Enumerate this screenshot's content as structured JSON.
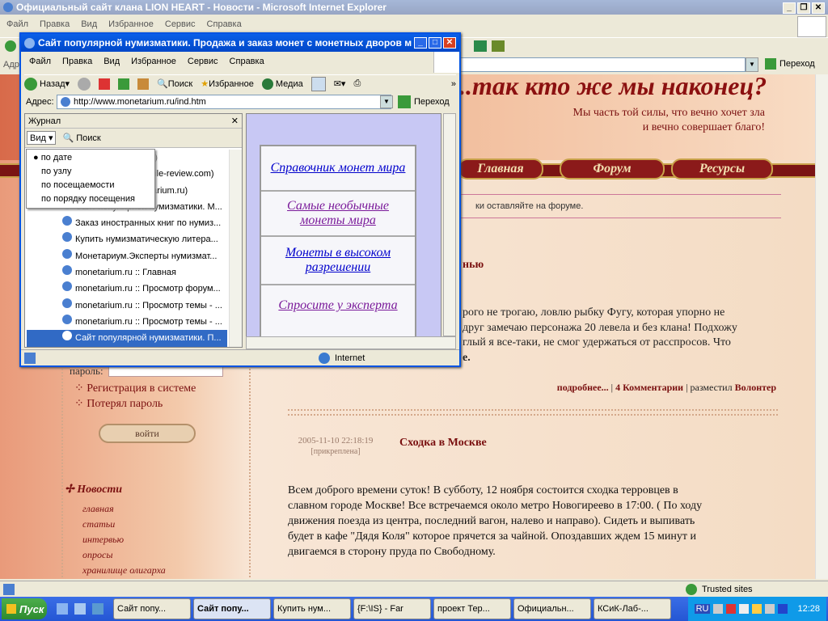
{
  "main_window": {
    "title": "Официальный сайт клана LION HEART - Новости - Microsoft Internet Explorer",
    "menu": [
      "Файл",
      "Правка",
      "Вид",
      "Избранное",
      "Сервис",
      "Справка"
    ],
    "addr_label": "Адр",
    "go_label": "Переход",
    "status_zone": "Trusted sites"
  },
  "site": {
    "banner_title": "...так кто же мы наконец?",
    "tagline_1": "Мы часть той силы, что вечно хочет зла",
    "tagline_2": "и вечно совершает благо!",
    "nav": [
      "Главная",
      "Форум",
      "Ресурсы"
    ],
    "ticker": "ки оставляйте на форуме.",
    "post1_title_fragment": "нью",
    "post1_lines": [
      "рого не трогаю, ловлю рыбку Фугу, которая упорно не",
      "друг замечаю персонажа 20 левела и без клана! Подхожу",
      "глый я все-таки, не смог удержаться от расспросов. Что"
    ],
    "post1_line4": "е.",
    "post1_more": "подробнее...",
    "post1_comments": "4 Комментарии",
    "post1_posted_by": "разместил",
    "post1_author": "Волонтер",
    "post2_date": "2005-11-10 22:18:19",
    "post2_pinned": "[прикреплена]",
    "post2_title": "Сходка в Москве",
    "post2_lines": [
      "Всем доброго времени суток! В субботу, 12 ноября состоится сходка терровцев в",
      "славном городе Москве! Все встречаемся около метро Новогиреево в 17:00. ( По ходу",
      "движения поезда из центра, последний вагон, налево и направо). Сидеть и выпивать",
      "будет в кафе \"Дядя Коля\" которое прячется за чайной. Опоздавших ждем 15 минут и",
      "двигаемся в сторону пруда по Свободному."
    ],
    "sidebar": {
      "password_label": "пароль:",
      "register": "Регистрация в системе",
      "lost_password": "Потерял пароль",
      "login_button": "войти",
      "news_header": "Новости",
      "links": [
        "главная",
        "статьи",
        "интервью",
        "опросы",
        "хранилище олигарха"
      ]
    }
  },
  "popup": {
    "title": "Сайт популярной нумизматики. Продажа и заказ монет с монетных дворов м...",
    "menu": [
      "Файл",
      "Правка",
      "Вид",
      "Избранное",
      "Сервис",
      "Справка"
    ],
    "back": "Назад",
    "search": "Поиск",
    "favorites": "Избранное",
    "media": "Медиа",
    "address_label": "Адрес:",
    "address": "http://www.monetarium.ru/ind.htm",
    "go": "Переход",
    "history_title": "Журнал",
    "view_label": "Вид",
    "search_label": "Поиск",
    "view_menu": [
      "по дате",
      "по узлу",
      "по посещаемости",
      "по порядку посещения"
    ],
    "history_fragments": [
      "ua)",
      "phile-review.com)",
      "etarium.ru)"
    ],
    "history_items": [
      "Сайт популярной нумизматики. М...",
      "Заказ иностранных книг по нумиз...",
      "Купить нумизматическую литера...",
      "Монетариум.Эксперты нумизмат...",
      "monetarium.ru :: Главная",
      "monetarium.ru :: Просмотр форум...",
      "monetarium.ru :: Просмотр темы - ...",
      "monetarium.ru :: Просмотр темы - ...",
      "Сайт популярной нумизматики. П..."
    ],
    "page_links": [
      "Справочник монет мира",
      "Самые необычные монеты мира",
      "Монеты в высоком разрешении",
      "Спросите у эксперта"
    ],
    "status_zone": "Internet"
  },
  "taskbar": {
    "start": "Пуск",
    "buttons": [
      "Сайт попу...",
      "Сайт попу...",
      "Купить нум...",
      "{F:\\IS} - Far",
      "проект Тер...",
      "Официальн...",
      "КСиК-Лаб-..."
    ],
    "lang": "RU",
    "clock": "12:28"
  }
}
